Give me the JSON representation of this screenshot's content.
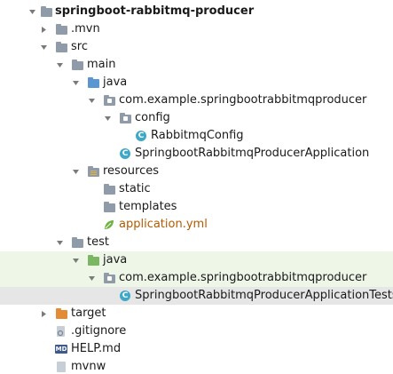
{
  "tree": {
    "root": "springboot-rabbitmq-producer",
    "mvn": ".mvn",
    "src": "src",
    "main": "main",
    "java": "java",
    "pkg_main": "com.example.springbootrabbitmqproducer",
    "config": "config",
    "rabbit_config": "RabbitmqConfig",
    "app_class": "SpringbootRabbitmqProducerApplication",
    "resources": "resources",
    "static": "static",
    "templates": "templates",
    "app_yml": "application.yml",
    "test": "test",
    "test_java": "java",
    "pkg_test": "com.example.springbootrabbitmqproducer",
    "test_class": "SpringbootRabbitmqProducerApplicationTests",
    "target": "target",
    "gitignore": ".gitignore",
    "help": "HELP.md",
    "mvnw": "mvnw"
  },
  "icons": {
    "class_letter": "C",
    "md_badge": "MD"
  },
  "colors": {
    "selected_row": "#e6e6e6",
    "test_row_tint": "#eef6e8"
  }
}
